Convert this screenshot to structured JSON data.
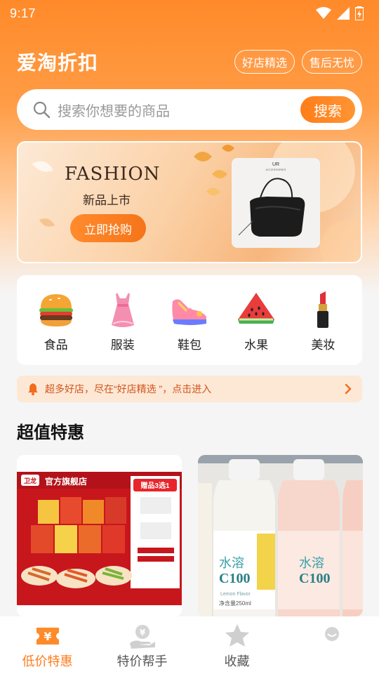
{
  "status": {
    "time": "9:17"
  },
  "header": {
    "title": "爱淘折扣",
    "pills": [
      "好店精选",
      "售后无忧"
    ]
  },
  "search": {
    "placeholder": "搜索你想要的商品",
    "button": "搜索"
  },
  "banner": {
    "title": "FASHION",
    "subtitle": "新品上市",
    "button": "立即抢购",
    "brand": "UR",
    "brand_sub": "ACCESSORIES"
  },
  "categories": [
    {
      "label": "食品",
      "icon": "burger-icon"
    },
    {
      "label": "服装",
      "icon": "dress-icon"
    },
    {
      "label": "鞋包",
      "icon": "sneaker-icon"
    },
    {
      "label": "水果",
      "icon": "watermelon-icon"
    },
    {
      "label": "美妆",
      "icon": "lipstick-icon"
    }
  ],
  "notice": {
    "text": "超多好店，尽在“好店精选 ”，点击进入"
  },
  "section": {
    "title": "超值特惠"
  },
  "products": [
    {
      "store_label": "官方旗舰店",
      "brand": "卫龙",
      "promo": "赠品3选1"
    },
    {
      "brand": "水溶",
      "name": "C100",
      "flavor": "Lemon Flavor",
      "volume": "净含量250ml"
    }
  ],
  "tabbar": [
    {
      "label": "低价特惠",
      "icon": "coupon-icon",
      "active": true
    },
    {
      "label": "特价帮手",
      "icon": "money-hand-icon",
      "active": false
    },
    {
      "label": "收藏",
      "icon": "star-icon",
      "active": false
    },
    {
      "label": "",
      "icon": "profile-icon",
      "active": false
    }
  ],
  "colors": {
    "accent": "#ff7a1a",
    "header_bg": "#ff8a2a"
  }
}
